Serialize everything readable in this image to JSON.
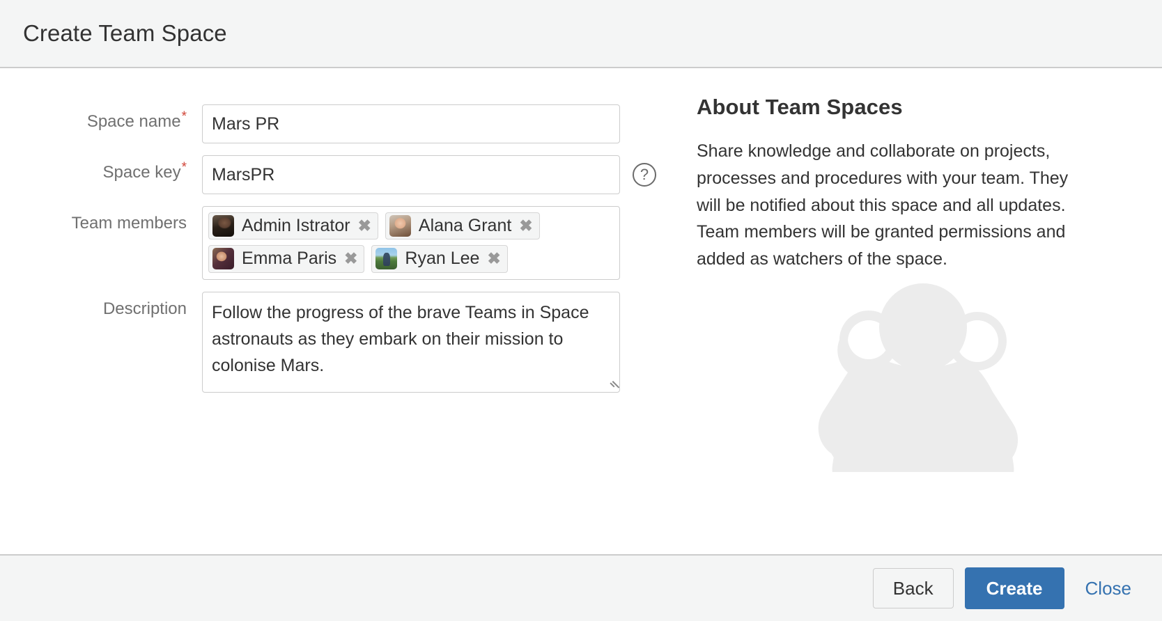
{
  "header": {
    "title": "Create Team Space"
  },
  "form": {
    "space_name": {
      "label": "Space name",
      "required_marker": "*",
      "value": "Mars PR",
      "placeholder": ""
    },
    "space_key": {
      "label": "Space key",
      "required_marker": "*",
      "value": "MarsPR",
      "placeholder": "",
      "help_icon": "help-circle-icon",
      "help_glyph": "?"
    },
    "team_members": {
      "label": "Team members",
      "remove_glyph": "✖",
      "chips": [
        {
          "name": "Admin Istrator",
          "avatar": "avatar-admin-istrator"
        },
        {
          "name": "Alana Grant",
          "avatar": "avatar-alana-grant"
        },
        {
          "name": "Emma Paris",
          "avatar": "avatar-emma-paris"
        },
        {
          "name": "Ryan Lee",
          "avatar": "avatar-ryan-lee"
        }
      ]
    },
    "description": {
      "label": "Description",
      "value": "Follow the progress of the brave Teams in Space astronauts as they embark on their mission to colonise Mars.",
      "placeholder": ""
    }
  },
  "info_panel": {
    "title": "About Team Spaces",
    "body": "Share knowledge and collaborate on projects, processes and procedures with your team. They will be notified about this space and all updates. Team members will be granted permissions and added as watchers of the space.",
    "illustration": "three-people-icon"
  },
  "footer": {
    "back_label": "Back",
    "create_label": "Create",
    "close_label": "Close"
  },
  "colors": {
    "primary": "#3572b0",
    "link": "#3572b0",
    "required": "#d04437",
    "chrome": "#f4f5f5",
    "border": "#cccccc",
    "illustration": "#ececec"
  }
}
